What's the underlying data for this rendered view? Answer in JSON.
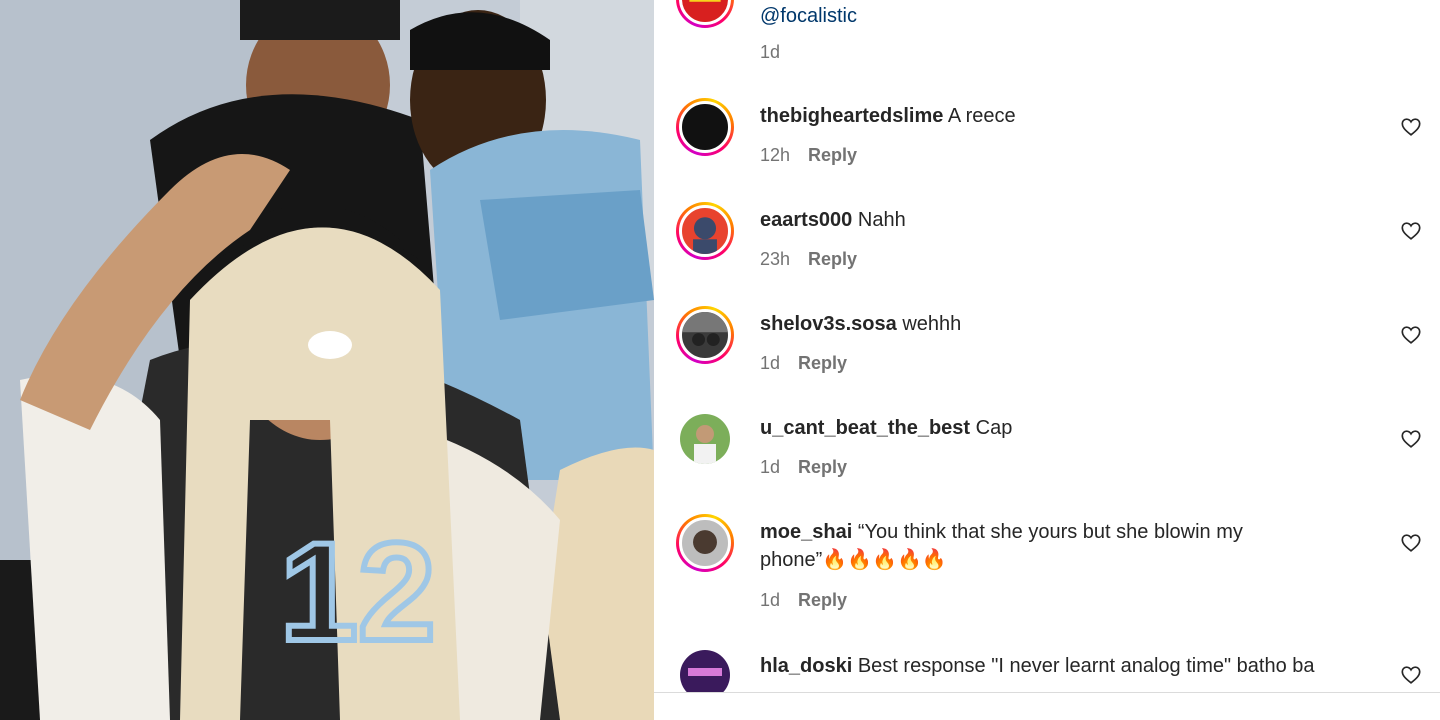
{
  "media": {
    "description_icon": "video-frame"
  },
  "comments": [
    {
      "username": "",
      "text": "@focalistic",
      "time": "1d",
      "reply_label": "",
      "avatar_color": "#d8201f"
    },
    {
      "username": "thebigheartedslime",
      "text": "A reece",
      "time": "12h",
      "reply_label": "Reply",
      "avatar_color": "#111111"
    },
    {
      "username": "eaarts000",
      "text": "Nahh",
      "time": "23h",
      "reply_label": "Reply",
      "avatar_color": "#e8432e"
    },
    {
      "username": "shelov3s.sosa",
      "text": "wehhh",
      "time": "1d",
      "reply_label": "Reply",
      "avatar_color": "#3a3a3a"
    },
    {
      "username": "u_cant_beat_the_best",
      "text": "Cap",
      "time": "1d",
      "reply_label": "Reply",
      "avatar_color": "#7cae5a"
    },
    {
      "username": "moe_shai",
      "text": "“You think that she yours but she blowin my phone”🔥🔥🔥🔥🔥",
      "time": "1d",
      "reply_label": "Reply",
      "avatar_color": "#8b8b8b"
    },
    {
      "username": "hla_doski",
      "text": "Best response \"I never learnt analog time\" batho ba",
      "time": "",
      "reply_label": "",
      "avatar_color": "#3a1a5c"
    }
  ],
  "icons": {
    "like": "heart-outline-icon"
  }
}
